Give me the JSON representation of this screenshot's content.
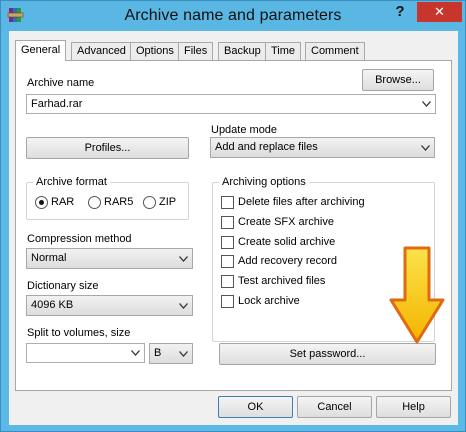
{
  "window": {
    "title": "Archive name and parameters",
    "help_glyph": "?",
    "close_glyph": "✕",
    "app_icon": "winrar-books-icon"
  },
  "tabs": [
    {
      "label": "General",
      "active": true
    },
    {
      "label": "Advanced",
      "active": false
    },
    {
      "label": "Options",
      "active": false
    },
    {
      "label": "Files",
      "active": false
    },
    {
      "label": "Backup",
      "active": false
    },
    {
      "label": "Time",
      "active": false
    },
    {
      "label": "Comment",
      "active": false
    }
  ],
  "general": {
    "archive_name_label": "Archive name",
    "browse_label": "Browse...",
    "archive_name_value": "Farhad.rar",
    "profiles_label": "Profiles...",
    "update_mode_label": "Update mode",
    "update_mode_value": "Add and replace files",
    "archive_format_label": "Archive format",
    "formats": [
      {
        "label": "RAR",
        "checked": true
      },
      {
        "label": "RAR5",
        "checked": false
      },
      {
        "label": "ZIP",
        "checked": false
      }
    ],
    "compression_method_label": "Compression method",
    "compression_method_value": "Normal",
    "dictionary_size_label": "Dictionary size",
    "dictionary_size_value": "4096 KB",
    "split_label": "Split to volumes, size",
    "split_value": "",
    "split_unit": "B",
    "archiving_options_label": "Archiving options",
    "options": [
      {
        "label": "Delete files after archiving",
        "checked": false
      },
      {
        "label": "Create SFX archive",
        "checked": false
      },
      {
        "label": "Create solid archive",
        "checked": false
      },
      {
        "label": "Add recovery record",
        "checked": false
      },
      {
        "label": "Test archived files",
        "checked": false
      },
      {
        "label": "Lock archive",
        "checked": false
      }
    ],
    "set_password_label": "Set password..."
  },
  "footer": {
    "ok_label": "OK",
    "cancel_label": "Cancel",
    "help_label": "Help"
  },
  "colors": {
    "title_bar": "#5ab7e4",
    "close_button": "#c7352d",
    "annotation_arrow_fill": "#f6c90e",
    "annotation_arrow_stroke": "#e06a10"
  }
}
